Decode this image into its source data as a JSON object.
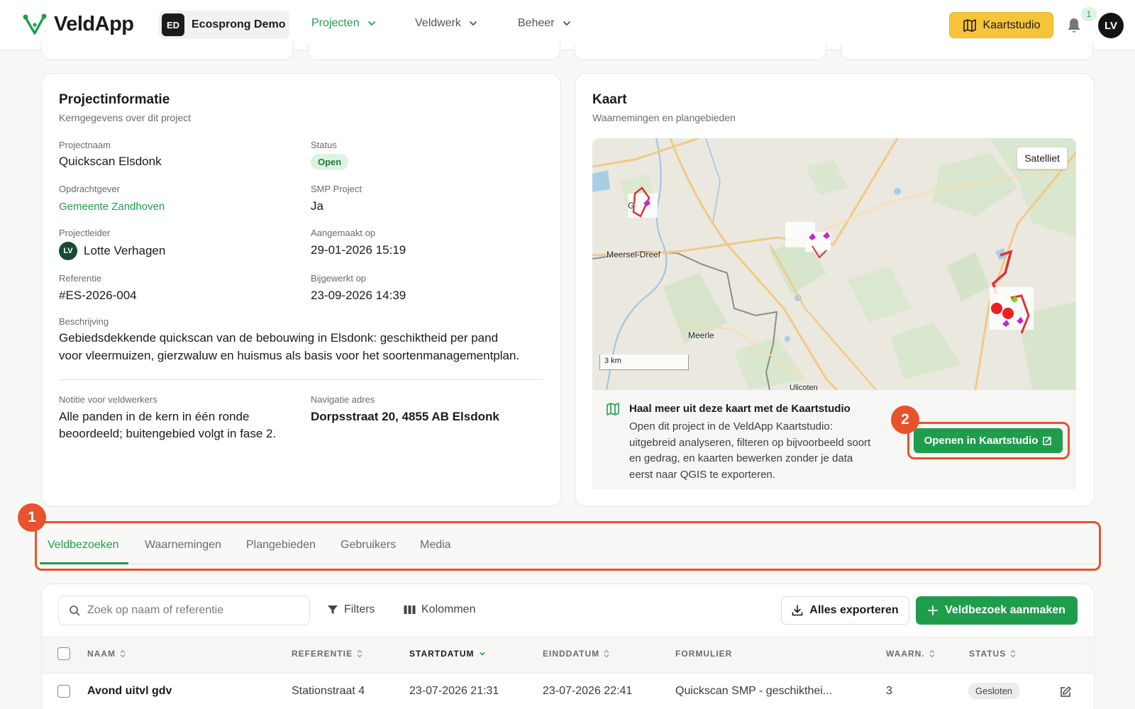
{
  "header": {
    "app_name": "VeldApp",
    "org_initials": "ED",
    "org_name": "Ecosprong Demo",
    "nav": [
      {
        "label": "Projecten"
      },
      {
        "label": "Veldwerk"
      },
      {
        "label": "Beheer"
      }
    ],
    "kaartstudio_label": "Kaartstudio",
    "notification_count": "1",
    "user_initials": "LV",
    "accent_color": "#1f9d4c",
    "kaartstudio_color": "#f5c43b"
  },
  "project_info": {
    "title": "Projectinformatie",
    "subtitle": "Kerngegevens over dit project",
    "fields": {
      "projectnaam_label": "Projectnaam",
      "projectnaam": "Quickscan Elsdonk",
      "status_label": "Status",
      "status": "Open",
      "opdrachtgever_label": "Opdrachtgever",
      "opdrachtgever": "Gemeente Zandhoven",
      "smp_label": "SMP Project",
      "smp": "Ja",
      "projectleider_label": "Projectleider",
      "projectleider_initials": "LV",
      "projectleider": "Lotte Verhagen",
      "aangemaakt_label": "Aangemaakt op",
      "aangemaakt": "29-01-2026 15:19",
      "referentie_label": "Referentie",
      "referentie": "#ES-2026-004",
      "bijgewerkt_label": "Bijgewerkt op",
      "bijgewerkt": "23-09-2026 14:39",
      "beschrijving_label": "Beschrijving",
      "beschrijving_line1": "Gebiedsdekkende quickscan van de bebouwing in Elsdonk: geschiktheid per pand",
      "beschrijving_line2": "voor vleermuizen, gierzwaluw en huismus als basis voor het soortenmanagementplan.",
      "notitie_label": "Notitie voor veldwerkers",
      "notitie_line1": "Alle panden in de kern in één ronde",
      "notitie_line2": "beoordeeld; buitengebied volgt in fase 2.",
      "adres_label": "Navigatie adres",
      "adres": "Dorpsstraat 20, 4855 AB Elsdonk"
    }
  },
  "map": {
    "title": "Kaart",
    "subtitle": "Waarnemingen en plangebieden",
    "satellite_label": "Satelliet",
    "scale_label": "3 km",
    "places": [
      "Meersel-Dreef",
      "Meerle",
      "Ulicoten",
      "G"
    ],
    "promo_title": "Haal meer uit deze kaart met de Kaartstudio",
    "promo_line1": "Open dit project in de VeldApp Kaartstudio:",
    "promo_line2": "uitgebreid analyseren, filteren op bijvoorbeeld soort",
    "promo_line3": "en gedrag, en kaarten bewerken zonder je data",
    "promo_line4": "eerst naar QGIS te exporteren.",
    "open_button": "Openen in Kaartstudio"
  },
  "callouts": {
    "one": "1",
    "two": "2"
  },
  "tabs": [
    {
      "label": "Veldbezoeken"
    },
    {
      "label": "Waarnemingen"
    },
    {
      "label": "Plangebieden"
    },
    {
      "label": "Gebruikers"
    },
    {
      "label": "Media"
    }
  ],
  "toolbar": {
    "search_placeholder": "Zoek op naam of referentie",
    "filters_label": "Filters",
    "columns_label": "Kolommen",
    "export_label": "Alles exporteren",
    "add_label": "Veldbezoek aanmaken"
  },
  "table": {
    "columns": [
      "NAAM",
      "REFERENTIE",
      "STARTDATUM",
      "EINDDATUM",
      "FORMULIER",
      "WAARN.",
      "STATUS"
    ],
    "rows": [
      {
        "naam": "Avond uitvl gdv",
        "referentie": "Stationstraat 4",
        "startdatum": "23-07-2026 21:31",
        "einddatum": "23-07-2026 22:41",
        "formulier": "Quickscan SMP - geschikthei...",
        "waarn": "3",
        "status": "Gesloten"
      }
    ]
  }
}
